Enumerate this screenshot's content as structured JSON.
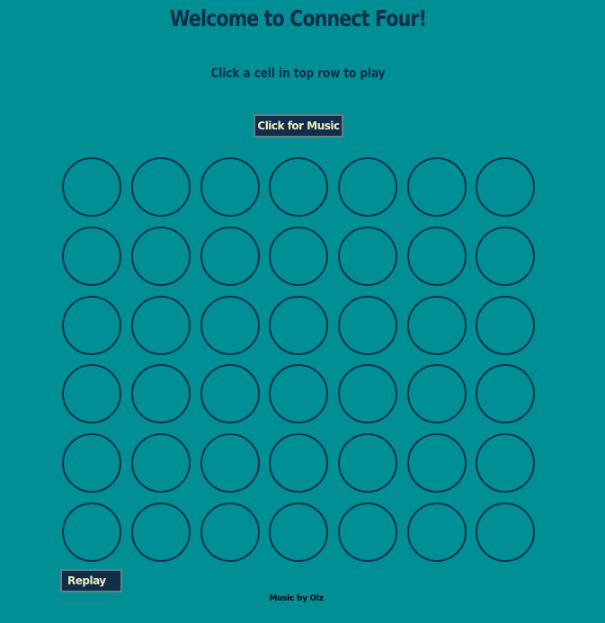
{
  "page": {
    "title": "Welcome to Connect Four!",
    "instructions": "Click a cell in top row to play",
    "music_button": "Click for Music",
    "replay_button": "Replay",
    "credit": "Music by Olz"
  },
  "board": {
    "rows": 6,
    "columns": 7,
    "cells": [
      [
        "",
        "",
        "",
        "",
        "",
        "",
        ""
      ],
      [
        "",
        "",
        "",
        "",
        "",
        "",
        ""
      ],
      [
        "",
        "",
        "",
        "",
        "",
        "",
        ""
      ],
      [
        "",
        "",
        "",
        "",
        "",
        "",
        ""
      ],
      [
        "",
        "",
        "",
        "",
        "",
        "",
        ""
      ],
      [
        "",
        "",
        "",
        "",
        "",
        "",
        ""
      ]
    ]
  },
  "colors": {
    "background": "#008f94",
    "text": "#0f2e4a",
    "button_bg": "#0f2e4a",
    "button_text": "#f2ecc4",
    "cell_border": "#0f3350"
  }
}
